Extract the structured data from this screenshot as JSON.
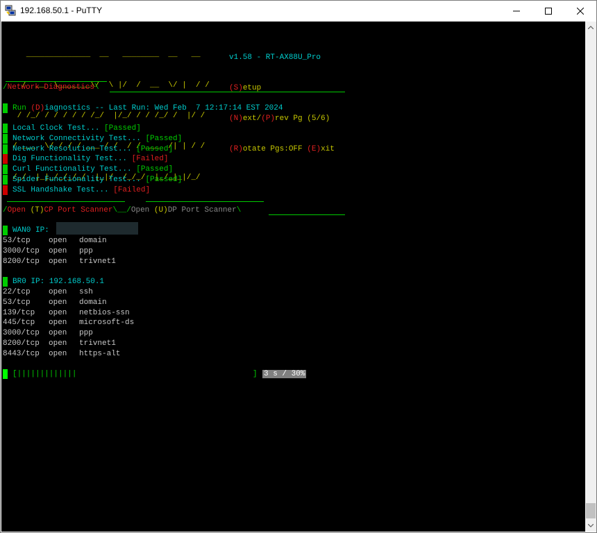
{
  "window": {
    "title": "192.168.50.1 - PuTTY",
    "icon": "putty-icon",
    "controls": [
      "minimize-icon",
      "maximize-icon",
      "close-icon"
    ]
  },
  "header": {
    "ascii_art": [
      "   ______________  __   ________  __   __",
      "  /  __  \\_______\\/  \\ |/  /  __  \\/ |  / /",
      " / /_/ / / / / / /_/  |/_/ / / /_/ /  |/ /",
      "/ ___  \\/ / / / ___ / /  / / ___  /| | / /",
      "/_/  |_|_/_/_/_/  |_|/  /_/_/  |_/_|_|/_/"
    ],
    "version_line": "v1.58 - RT-AX88U_Pro",
    "menu": [
      {
        "key": "(S)",
        "label": "etup"
      },
      {
        "key": "(N)",
        "label": "ext/",
        "key2": "(P)",
        "label2": "rev Pg (5/6)"
      },
      {
        "key": "(R)",
        "label": "otate Pgs:OFF",
        "key2": "(E)",
        "label2": "xit"
      }
    ]
  },
  "diagnostics": {
    "section_title": "Network Diagnostics",
    "run_prefix": "Run ",
    "run_key": "(D)",
    "run_suffix": "iagnostics -- Last Run: Wed Feb  7 12:17:14 EST 2024",
    "tests": [
      {
        "name": "Local Clock Test...",
        "result": "[Passed]",
        "status": "pass"
      },
      {
        "name": "Network Connectivity Test...",
        "result": "[Passed]",
        "status": "pass"
      },
      {
        "name": "Network Resolution Test...",
        "result": "[Passed]",
        "status": "pass"
      },
      {
        "name": "Dig Functionality Test...",
        "result": "[Failed]",
        "status": "fail"
      },
      {
        "name": "Curl Functionality Test...",
        "result": "[Passed]",
        "status": "pass"
      },
      {
        "name": "Spider Functionality Test...",
        "result": "[Passed]",
        "status": "pass"
      },
      {
        "name": "SSL Handshake Test...",
        "result": "[Failed]",
        "status": "fail"
      }
    ]
  },
  "scanner": {
    "tcp_tab_open": "Open ",
    "tcp_tab_key": "(T)",
    "tcp_tab_rest": "CP Port Scanner",
    "udp_tab_open": "Open ",
    "udp_tab_key": "(U)",
    "udp_tab_rest": "DP Port Scanner",
    "wan_label": "WAN0 IP:",
    "wan_ports": [
      {
        "port": "53/tcp",
        "state": "open",
        "service": "domain"
      },
      {
        "port": "3000/tcp",
        "state": "open",
        "service": "ppp"
      },
      {
        "port": "8200/tcp",
        "state": "open",
        "service": "trivnet1"
      }
    ],
    "br_label": "BR0 IP: 192.168.50.1",
    "br_ports": [
      {
        "port": "22/tcp",
        "state": "open",
        "service": "ssh"
      },
      {
        "port": "53/tcp",
        "state": "open",
        "service": "domain"
      },
      {
        "port": "139/tcp",
        "state": "open",
        "service": "netbios-ssn"
      },
      {
        "port": "445/tcp",
        "state": "open",
        "service": "microsoft-ds"
      },
      {
        "port": "3000/tcp",
        "state": "open",
        "service": "ppp"
      },
      {
        "port": "8200/tcp",
        "state": "open",
        "service": "trivnet1"
      },
      {
        "port": "8443/tcp",
        "state": "open",
        "service": "https-alt"
      }
    ]
  },
  "progress": {
    "bar_text": "[|||||||||||||",
    "bar_end": "]",
    "label": "3 s / 30%",
    "percent": 30
  },
  "colors": {
    "terminal_bg": "#000000",
    "cyan": "#00cccc",
    "green": "#00cc00",
    "red": "#e02020",
    "yellow": "#c8c800"
  }
}
